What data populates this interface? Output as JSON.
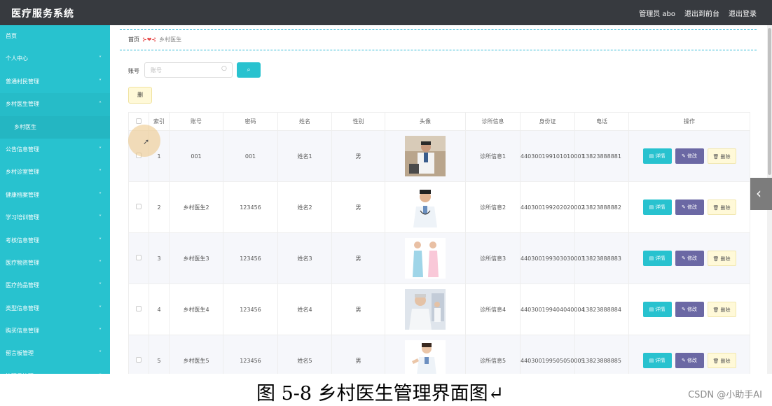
{
  "header": {
    "app_title": "医疗服务系统",
    "user_label": "管理员 abo",
    "back_to_front": "退出到前台",
    "logout": "退出登录"
  },
  "sidebar": {
    "items": [
      {
        "label": "首页",
        "chevron": ""
      },
      {
        "label": "个人中心",
        "chevron": "˅"
      },
      {
        "label": "普通村民管理",
        "chevron": "˅"
      },
      {
        "label": "乡村医生管理",
        "chevron": "˄"
      },
      {
        "label": "乡村医生",
        "chevron": "",
        "sub": true
      },
      {
        "label": "公告信息管理",
        "chevron": "˅"
      },
      {
        "label": "乡村诊室管理",
        "chevron": "˅"
      },
      {
        "label": "健康档案管理",
        "chevron": "˅"
      },
      {
        "label": "学习培训管理",
        "chevron": "˅"
      },
      {
        "label": "考核信息管理",
        "chevron": "˅"
      },
      {
        "label": "医疗物资管理",
        "chevron": "˅"
      },
      {
        "label": "医疗药品管理",
        "chevron": "˅"
      },
      {
        "label": "类型信息管理",
        "chevron": "˅"
      },
      {
        "label": "购买信息管理",
        "chevron": "˅"
      },
      {
        "label": "留言板管理",
        "chevron": "˅"
      },
      {
        "label": "管理员管理",
        "chevron": "˅"
      }
    ]
  },
  "breadcrumb": {
    "home": "首页",
    "separator": "⊱❤⊰",
    "current": "乡村医生"
  },
  "search": {
    "label": "账号",
    "placeholder": "账号",
    "button_icon": "search-icon"
  },
  "toolbar": {
    "batch_delete_label": "删"
  },
  "table": {
    "headers": [
      "",
      "索引",
      "账号",
      "密码",
      "姓名",
      "性别",
      "头像",
      "诊所信息",
      "身份证",
      "电话",
      "操作"
    ],
    "rows": [
      {
        "index": "1",
        "account": "001",
        "password": "001",
        "name": "姓名1",
        "gender": "男",
        "clinic": "诊所信息1",
        "id_card": "440300199101010001",
        "phone": "13823888881",
        "avatar": "doctor-male-seated"
      },
      {
        "index": "2",
        "account": "乡村医生2",
        "password": "123456",
        "name": "姓名2",
        "gender": "男",
        "clinic": "诊所信息2",
        "id_card": "440300199202020002",
        "phone": "13823888882",
        "avatar": "doctor-male-standing"
      },
      {
        "index": "3",
        "account": "乡村医生3",
        "password": "123456",
        "name": "姓名3",
        "gender": "男",
        "clinic": "诊所信息3",
        "id_card": "440300199303030003",
        "phone": "13823888883",
        "avatar": "two-nurses"
      },
      {
        "index": "4",
        "account": "乡村医生4",
        "password": "123456",
        "name": "姓名4",
        "gender": "男",
        "clinic": "诊所信息4",
        "id_card": "440300199404040004",
        "phone": "13823888884",
        "avatar": "doctor-elderly"
      },
      {
        "index": "5",
        "account": "乡村医生5",
        "password": "123456",
        "name": "姓名5",
        "gender": "男",
        "clinic": "诊所信息5",
        "id_card": "440300199505050005",
        "phone": "13823888885",
        "avatar": "doctor-female"
      }
    ],
    "actions": {
      "detail": "▤ 详情",
      "edit": "✎ 修改",
      "delete": "🗑 删除"
    }
  },
  "caption": "图 5-8 乡村医生管理界面图↵",
  "watermark": "CSDN @小助手AI",
  "colors": {
    "accent": "#28c2cf",
    "header_bg": "#373a3f",
    "edit_button": "#6b68a4",
    "delete_button": "#fff9d8"
  }
}
